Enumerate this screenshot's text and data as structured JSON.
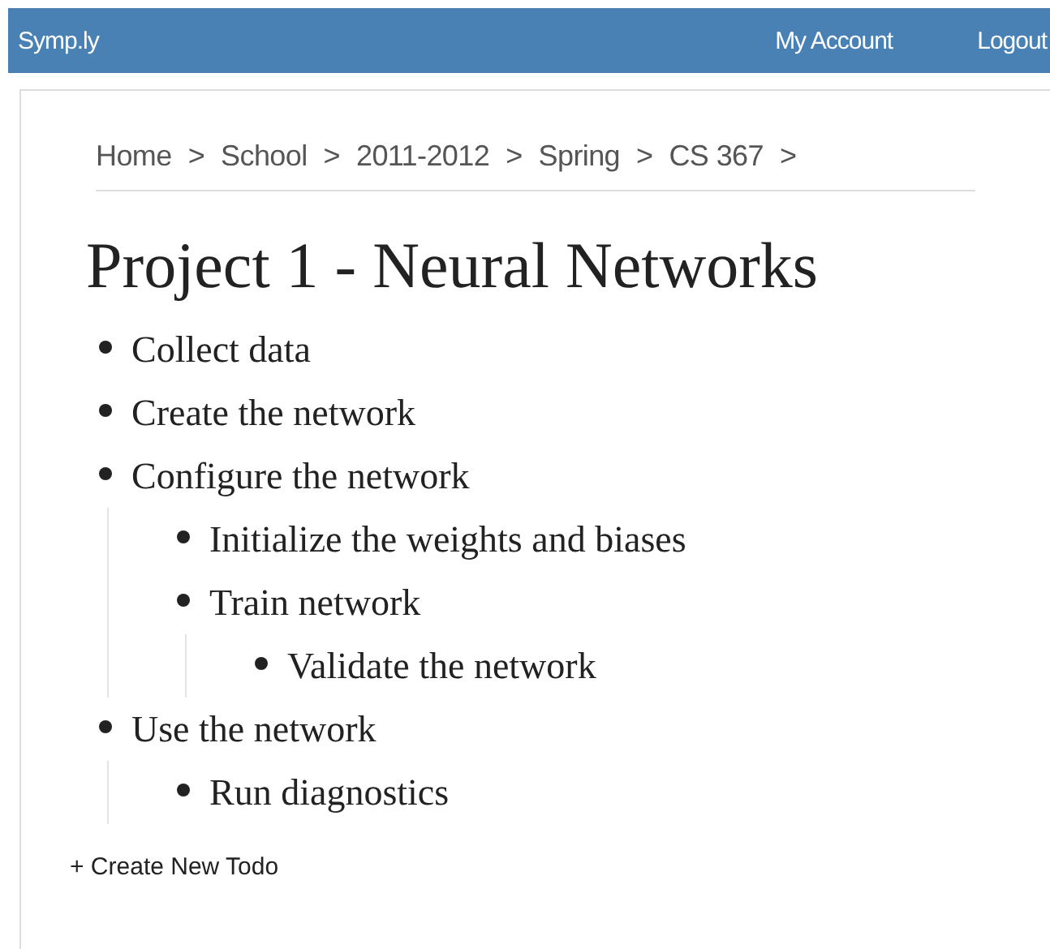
{
  "navbar": {
    "brand": "Symp.ly",
    "links": [
      "My Account",
      "Logout"
    ]
  },
  "breadcrumb": [
    {
      "label": "Home",
      "separator": ">"
    },
    {
      "label": "School",
      "separator": ">"
    },
    {
      "label": "2011-2012",
      "separator": ">"
    },
    {
      "label": "Spring",
      "separator": ">"
    },
    {
      "label": "CS 367",
      "separator": ">"
    }
  ],
  "title": "Project 1 - Neural Networks",
  "todos": [
    {
      "label": "Collect data"
    },
    {
      "label": "Create the network"
    },
    {
      "label": "Configure the network",
      "children": [
        {
          "label": "Initialize the weights and biases"
        },
        {
          "label": "Train network",
          "children": [
            {
              "label": "Validate the network"
            }
          ]
        }
      ]
    },
    {
      "label": "Use the network",
      "children": [
        {
          "label": "Run diagnostics"
        }
      ]
    }
  ],
  "create_link": "+ Create New Todo"
}
